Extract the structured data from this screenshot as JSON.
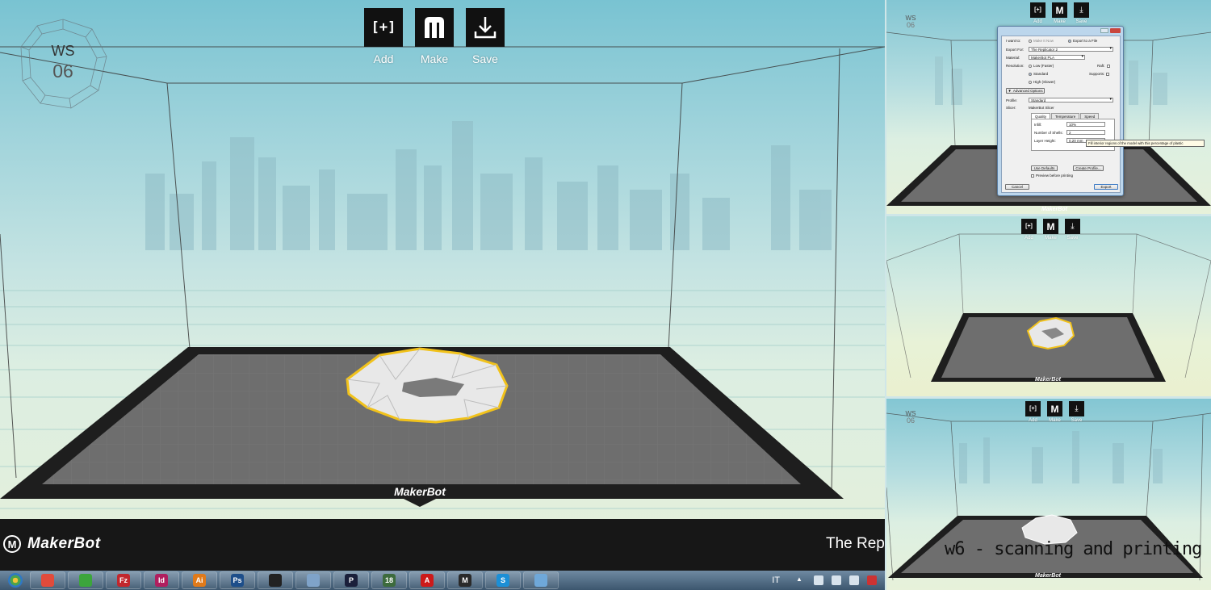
{
  "toolbar": {
    "add_label": "Add",
    "make_label": "Make",
    "save_label": "Save",
    "add_glyph": "[+]",
    "make_glyph": "M"
  },
  "badge": {
    "line1": "WS",
    "line2": "06"
  },
  "footer": {
    "logo_glyph": "M",
    "brand": "MakerBot",
    "printer_name": "The Rep"
  },
  "bed": {
    "brand": "MakerBot"
  },
  "taskbar": {
    "language": "IT",
    "apps": [
      {
        "name": "chrome-icon",
        "glyph": "",
        "color": "#e14b3b"
      },
      {
        "name": "spotify-icon",
        "glyph": "",
        "color": "#3ca53c"
      },
      {
        "name": "filezilla-icon",
        "glyph": "Fz",
        "color": "#c1272d"
      },
      {
        "name": "indesign-icon",
        "glyph": "Id",
        "color": "#b01f5f"
      },
      {
        "name": "illustrator-icon",
        "glyph": "Ai",
        "color": "#e07a1a"
      },
      {
        "name": "photoshop-icon",
        "glyph": "Ps",
        "color": "#1d4e8a"
      },
      {
        "name": "inkscape-icon",
        "glyph": "",
        "color": "#222222"
      },
      {
        "name": "calculator-icon",
        "glyph": "",
        "color": "#7fa3c9"
      },
      {
        "name": "p-app-icon",
        "glyph": "P",
        "color": "#1a1f3a"
      },
      {
        "name": "calendar-icon",
        "glyph": "18",
        "color": "#3d6b3d"
      },
      {
        "name": "acrobat-icon",
        "glyph": "A",
        "color": "#cc1a1a"
      },
      {
        "name": "makerbot-icon",
        "glyph": "M",
        "color": "#2a2a2a"
      },
      {
        "name": "skype-icon",
        "glyph": "S",
        "color": "#1c8fd6"
      },
      {
        "name": "explorer-icon",
        "glyph": "",
        "color": "#6fa8d9"
      }
    ]
  },
  "dialog": {
    "i_want_to": "I want to:",
    "make_it_now": "Make It Now",
    "export_to_file": "Export to a File",
    "export_for": "Export For:",
    "export_for_value": "The Replicator 2",
    "material": "Material:",
    "material_value": "MakerBot PLA",
    "resolution": "Resolution:",
    "res_low": "Low (Faster)",
    "res_standard": "Standard",
    "res_high": "High (Slower)",
    "raft": "Raft:",
    "supports": "Supports:",
    "advanced_options": "Advanced Options",
    "profile": "Profile:",
    "profile_value": "Standard",
    "slicer": "Slicer:",
    "slicer_value": "MakerBot Slicer",
    "tab_quality": "Quality",
    "tab_temperature": "Temperature",
    "tab_speed": "Speed",
    "infill": "Infill:",
    "infill_value": "10%",
    "shells": "Number of Shells:",
    "shells_value": "2",
    "layer_height": "Layer Height:",
    "layer_height_value": "0.20 mm",
    "use_defaults": "Use Defaults",
    "create_profile": "Create Profile...",
    "preview": "Preview before printing",
    "cancel": "Cancel",
    "export": "Export",
    "tooltip": "Fill interior regions of the model with this percentage of plastic"
  },
  "caption": "w6 - scanning and printing"
}
